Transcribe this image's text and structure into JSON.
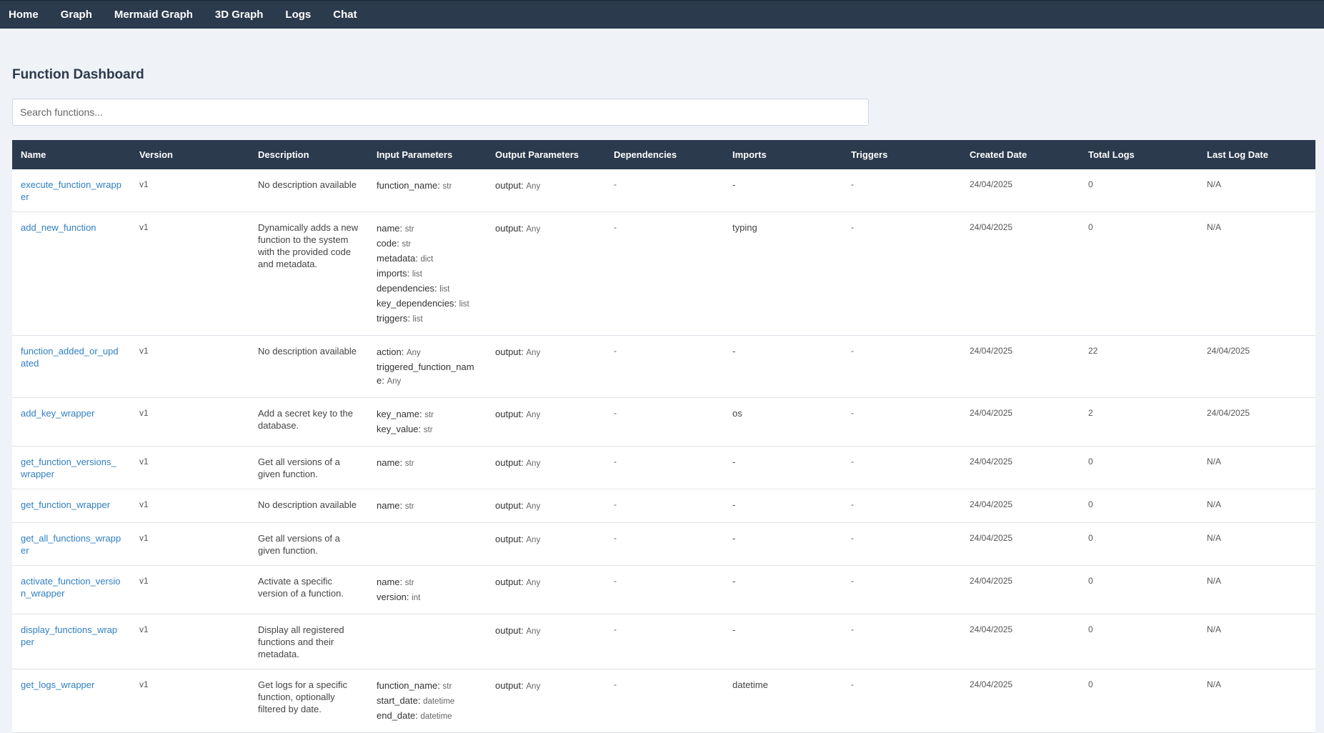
{
  "nav": {
    "items": [
      "Home",
      "Graph",
      "Mermaid Graph",
      "3D Graph",
      "Logs",
      "Chat"
    ]
  },
  "page": {
    "title": "Function Dashboard",
    "search_placeholder": "Search functions..."
  },
  "table": {
    "columns": [
      "Name",
      "Version",
      "Description",
      "Input Parameters",
      "Output Parameters",
      "Dependencies",
      "Imports",
      "Triggers",
      "Created Date",
      "Total Logs",
      "Last Log Date"
    ],
    "rows": [
      {
        "name": "execute_function_wrapper",
        "version": "v1",
        "description": "No description available",
        "inputs": [
          {
            "n": "function_name",
            "t": "str"
          }
        ],
        "output": {
          "n": "output",
          "t": "Any"
        },
        "dependencies": "-",
        "imports": "-",
        "triggers": "-",
        "created": "24/04/2025",
        "logs": "0",
        "last_log": "N/A"
      },
      {
        "name": "add_new_function",
        "version": "v1",
        "description": "Dynamically adds a new function to the system with the provided code and metadata.",
        "inputs": [
          {
            "n": "name",
            "t": "str"
          },
          {
            "n": "code",
            "t": "str"
          },
          {
            "n": "metadata",
            "t": "dict"
          },
          {
            "n": "imports",
            "t": "list"
          },
          {
            "n": "dependencies",
            "t": "list"
          },
          {
            "n": "key_dependencies",
            "t": "list"
          },
          {
            "n": "triggers",
            "t": "list"
          }
        ],
        "output": {
          "n": "output",
          "t": "Any"
        },
        "dependencies": "-",
        "imports": "typing",
        "triggers": "-",
        "created": "24/04/2025",
        "logs": "0",
        "last_log": "N/A"
      },
      {
        "name": "function_added_or_updated",
        "version": "v1",
        "description": "No description available",
        "inputs": [
          {
            "n": "action",
            "t": "Any"
          },
          {
            "n": "triggered_function_name",
            "t": "Any"
          }
        ],
        "output": {
          "n": "output",
          "t": "Any"
        },
        "dependencies": "-",
        "imports": "-",
        "triggers": "-",
        "created": "24/04/2025",
        "logs": "22",
        "last_log": "24/04/2025"
      },
      {
        "name": "add_key_wrapper",
        "version": "v1",
        "description": "Add a secret key to the database.",
        "inputs": [
          {
            "n": "key_name",
            "t": "str"
          },
          {
            "n": "key_value",
            "t": "str"
          }
        ],
        "output": {
          "n": "output",
          "t": "Any"
        },
        "dependencies": "-",
        "imports": "os",
        "triggers": "-",
        "created": "24/04/2025",
        "logs": "2",
        "last_log": "24/04/2025"
      },
      {
        "name": "get_function_versions_wrapper",
        "version": "v1",
        "description": "Get all versions of a given function.",
        "inputs": [
          {
            "n": "name",
            "t": "str"
          }
        ],
        "output": {
          "n": "output",
          "t": "Any"
        },
        "dependencies": "-",
        "imports": "-",
        "triggers": "-",
        "created": "24/04/2025",
        "logs": "0",
        "last_log": "N/A"
      },
      {
        "name": "get_function_wrapper",
        "version": "v1",
        "description": "No description available",
        "inputs": [
          {
            "n": "name",
            "t": "str"
          }
        ],
        "output": {
          "n": "output",
          "t": "Any"
        },
        "dependencies": "-",
        "imports": "-",
        "triggers": "-",
        "created": "24/04/2025",
        "logs": "0",
        "last_log": "N/A"
      },
      {
        "name": "get_all_functions_wrapper",
        "version": "v1",
        "description": "Get all versions of a given function.",
        "inputs": [],
        "output": {
          "n": "output",
          "t": "Any"
        },
        "dependencies": "-",
        "imports": "-",
        "triggers": "-",
        "created": "24/04/2025",
        "logs": "0",
        "last_log": "N/A"
      },
      {
        "name": "activate_function_version_wrapper",
        "version": "v1",
        "description": "Activate a specific version of a function.",
        "inputs": [
          {
            "n": "name",
            "t": "str"
          },
          {
            "n": "version",
            "t": "int"
          }
        ],
        "output": {
          "n": "output",
          "t": "Any"
        },
        "dependencies": "-",
        "imports": "-",
        "triggers": "-",
        "created": "24/04/2025",
        "logs": "0",
        "last_log": "N/A"
      },
      {
        "name": "display_functions_wrapper",
        "version": "v1",
        "description": "Display all registered functions and their metadata.",
        "inputs": [],
        "output": {
          "n": "output",
          "t": "Any"
        },
        "dependencies": "-",
        "imports": "-",
        "triggers": "-",
        "created": "24/04/2025",
        "logs": "0",
        "last_log": "N/A"
      },
      {
        "name": "get_logs_wrapper",
        "version": "v1",
        "description": "Get logs for a specific function, optionally filtered by date.",
        "inputs": [
          {
            "n": "function_name",
            "t": "str"
          },
          {
            "n": "start_date",
            "t": "datetime"
          },
          {
            "n": "end_date",
            "t": "datetime"
          }
        ],
        "output": {
          "n": "output",
          "t": "Any"
        },
        "dependencies": "-",
        "imports": "datetime",
        "triggers": "-",
        "created": "24/04/2025",
        "logs": "0",
        "last_log": "N/A"
      }
    ]
  }
}
